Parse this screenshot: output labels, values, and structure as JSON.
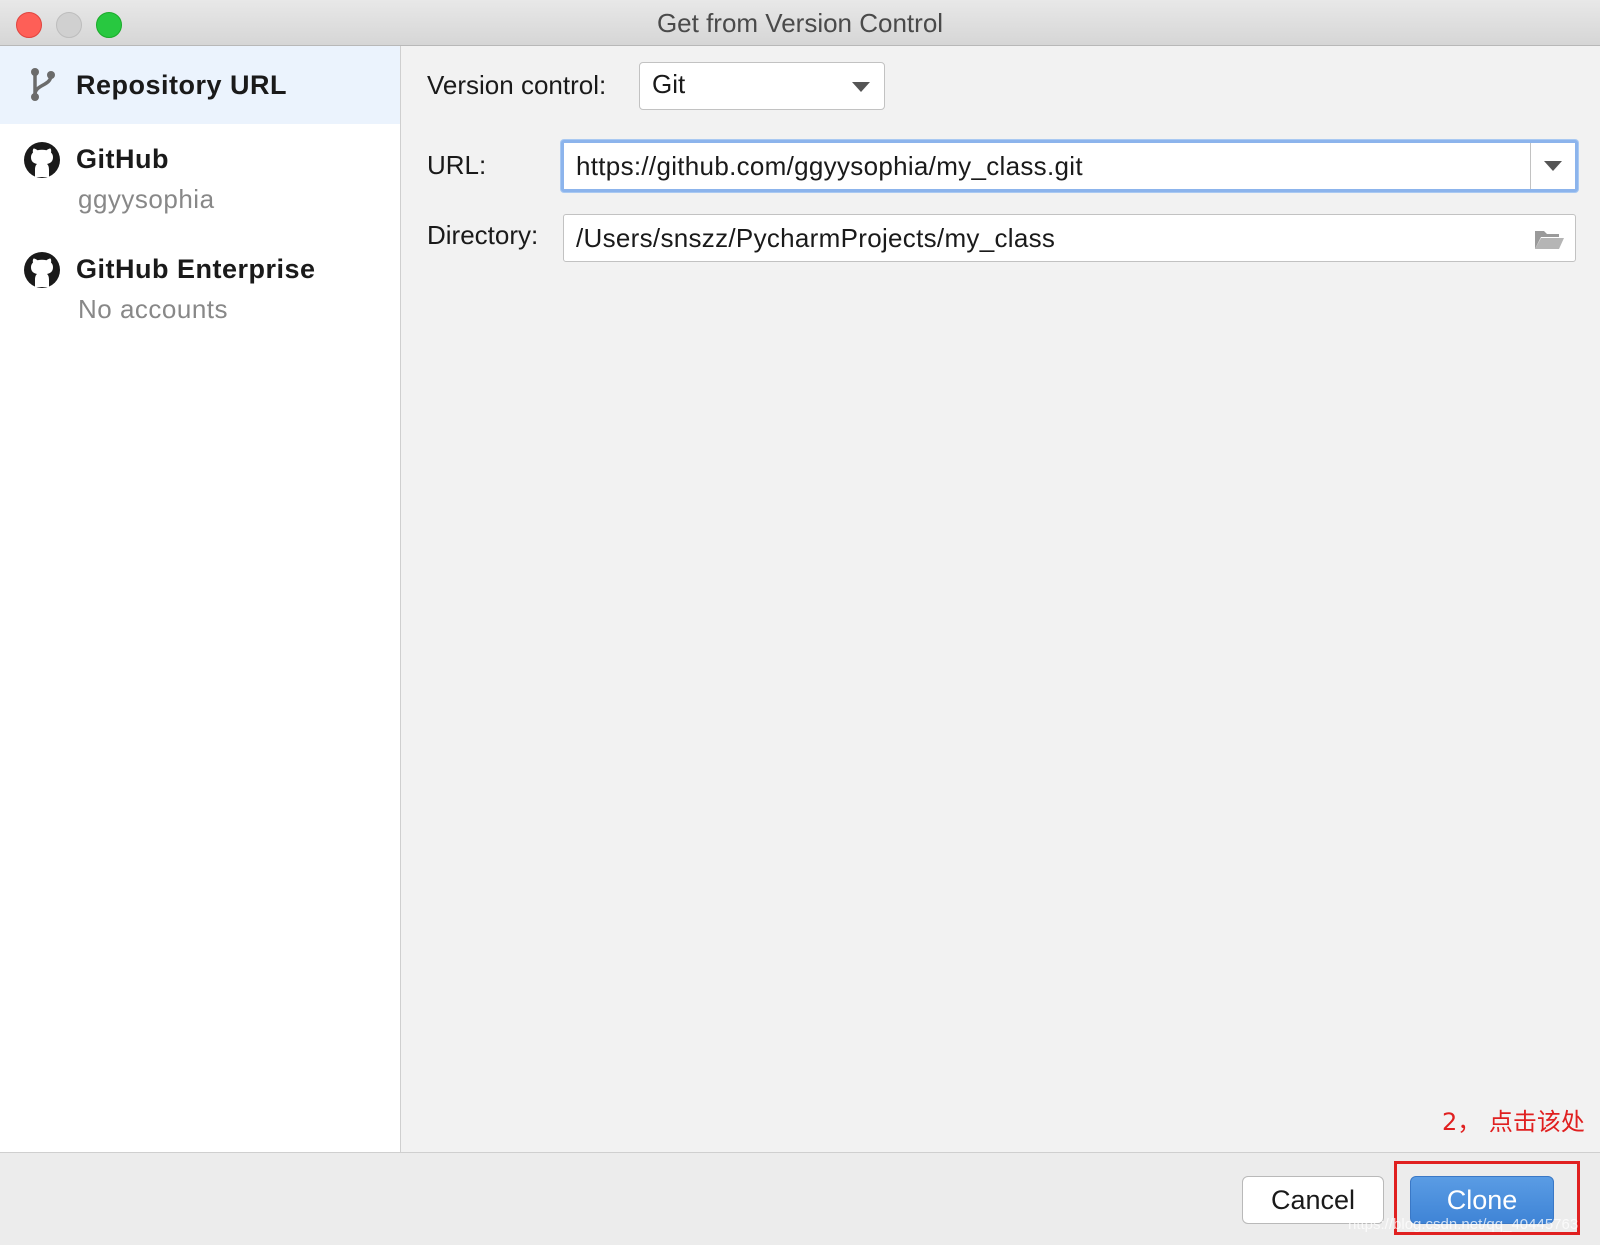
{
  "window": {
    "title": "Get from Version Control"
  },
  "sidebar": {
    "items": [
      {
        "label": "Repository URL",
        "sublabel": "",
        "icon": "git-branch-icon",
        "selected": true
      },
      {
        "label": "GitHub",
        "sublabel": "ggyysophia",
        "icon": "github-icon",
        "selected": false
      },
      {
        "label": "GitHub Enterprise",
        "sublabel": "No accounts",
        "icon": "github-icon",
        "selected": false
      }
    ]
  },
  "form": {
    "version_control_label": "Version control:",
    "version_control_value": "Git",
    "url_label": "URL:",
    "url_value": "https://github.com/ggyysophia/my_class.git",
    "directory_label": "Directory:",
    "directory_value": "/Users/snszz/PycharmProjects/my_class"
  },
  "buttons": {
    "cancel_label": "Cancel",
    "clone_label": "Clone"
  },
  "annotation": {
    "text": "2， 点击该处",
    "color": "#e02020"
  },
  "watermark": "https://blog.csdn.net/qq_40445763",
  "colors": {
    "accent": "#4a90e2",
    "selected_bg": "#ebf3fd",
    "focus_ring": "#8cb4ec"
  }
}
